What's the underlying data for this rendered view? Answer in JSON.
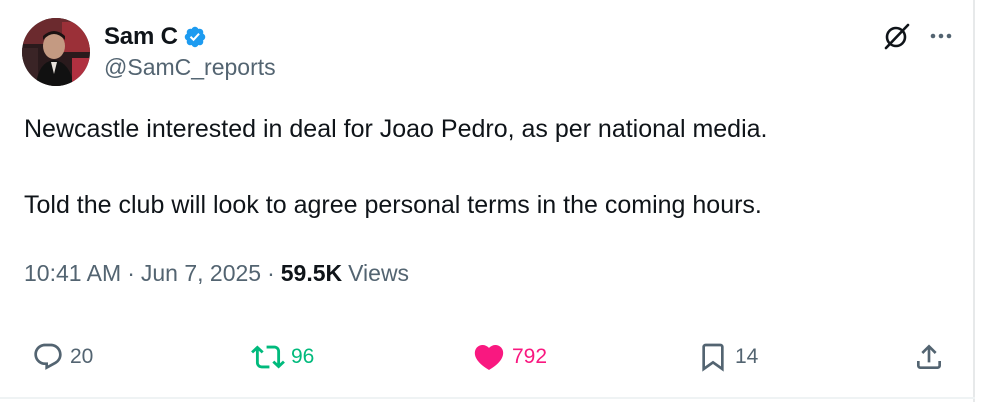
{
  "author": {
    "display_name": "Sam C",
    "handle": "@SamC_reports",
    "verified": true,
    "verified_color": "#1d9bf0"
  },
  "header_icons": [
    "grok-icon",
    "more-icon"
  ],
  "tweet": {
    "paragraphs": [
      "Newcastle interested in deal for Joao Pedro, as per national media.",
      "Told the club will look to agree personal terms in the coming hours."
    ]
  },
  "meta": {
    "time": "10:41 AM",
    "separator": "·",
    "date": "Jun 7, 2025",
    "views_count": "59.5K",
    "views_label": "Views"
  },
  "actions": {
    "reply": {
      "icon": "reply-icon",
      "count": "20"
    },
    "retweet": {
      "icon": "retweet-icon",
      "count": "96",
      "color": "#00ba7c"
    },
    "like": {
      "icon": "heart-icon",
      "count": "792",
      "color": "#f91880"
    },
    "bookmark": {
      "icon": "bookmark-icon",
      "count": "14"
    },
    "share": {
      "icon": "share-icon"
    }
  },
  "colors": {
    "text": "#0f1419",
    "secondary": "#536471",
    "border": "#e7e9ea"
  }
}
